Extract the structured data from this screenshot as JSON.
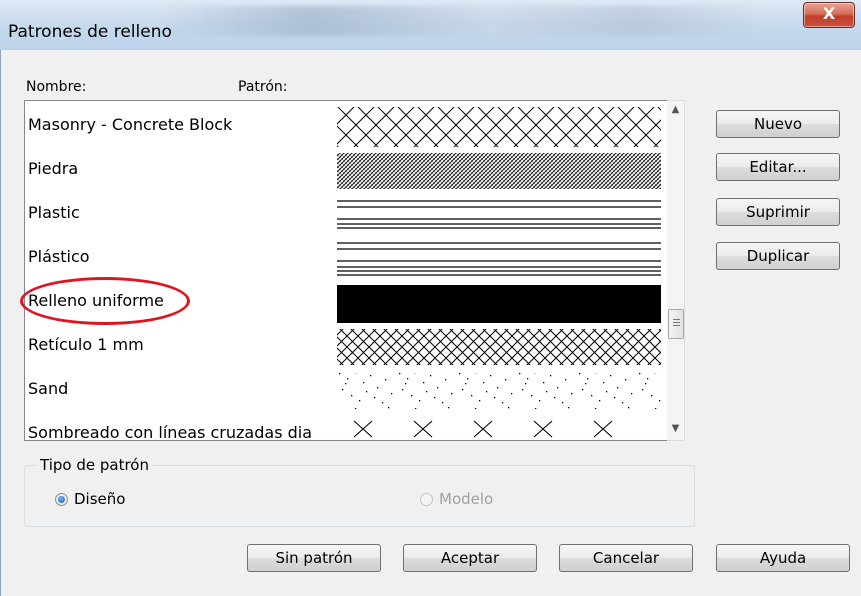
{
  "window": {
    "title": "Patrones de relleno",
    "close_label": "X"
  },
  "columns": {
    "name_header": "Nombre:",
    "pattern_header": "Patrón:"
  },
  "patterns": [
    {
      "name": "Masonry - Concrete  Block",
      "pattern": "diamond-crosshatch-large"
    },
    {
      "name": "Piedra",
      "pattern": "fine-crosshatch"
    },
    {
      "name": "Plastic",
      "pattern": "grouped-horizontal-lines"
    },
    {
      "name": "Plástico",
      "pattern": "grouped-horizontal-lines"
    },
    {
      "name": "Relleno uniforme",
      "pattern": "solid-fill",
      "highlighted": true
    },
    {
      "name": "Retículo 1 mm",
      "pattern": "diamond-crosshatch-small"
    },
    {
      "name": "Sand",
      "pattern": "dot-stipple"
    },
    {
      "name": "Sombreado con líneas cruzadas dia",
      "pattern": "sparse-x"
    }
  ],
  "side_buttons": {
    "new": "Nuevo",
    "edit": "Editar...",
    "delete": "Suprimir",
    "duplicate": "Duplicar"
  },
  "pattern_type": {
    "group_label": "Tipo de patrón",
    "options": [
      {
        "label": "Diseño",
        "selected": true,
        "enabled": true
      },
      {
        "label": "Modelo",
        "selected": false,
        "enabled": false
      }
    ]
  },
  "footer_buttons": {
    "no_pattern": "Sin patrón",
    "ok": "Aceptar",
    "cancel": "Cancelar",
    "help": "Ayuda"
  },
  "colors": {
    "highlight_ring": "#e0141e",
    "radio_selected": "#1a5fb4"
  }
}
